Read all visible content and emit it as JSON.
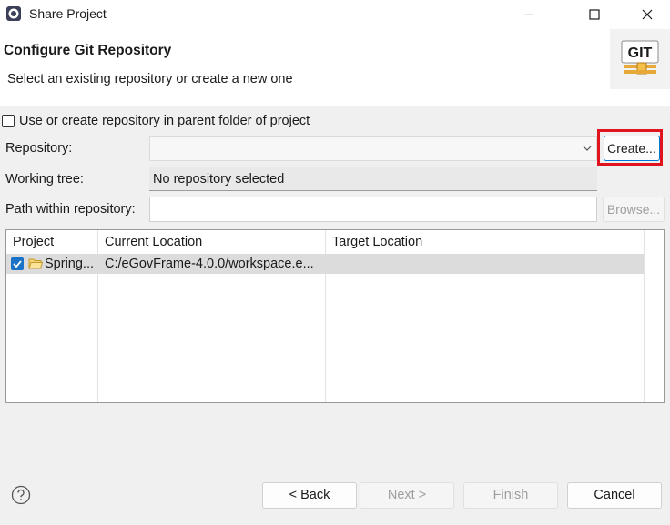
{
  "window": {
    "title": "Share Project"
  },
  "header": {
    "title": "Configure Git Repository",
    "subtitle": "Select an existing repository or create a new one",
    "logo_text": "GIT"
  },
  "form": {
    "parent_folder_checkbox": {
      "label": "Use or create repository in parent folder of project",
      "checked": false
    },
    "repository_label": "Repository:",
    "repository_value": "",
    "create_button": "Create...",
    "working_tree_label": "Working tree:",
    "working_tree_value": "No repository selected",
    "path_label": "Path within repository:",
    "path_value": "",
    "browse_button": "Browse..."
  },
  "table": {
    "columns": [
      "Project",
      "Current Location",
      "Target Location"
    ],
    "rows": [
      {
        "project": "Spring...",
        "current_location": "C:/eGovFrame-4.0.0/workspace.e...",
        "target_location": "",
        "checked": true
      }
    ]
  },
  "footer": {
    "back": "< Back",
    "next": "Next >",
    "finish": "Finish",
    "cancel": "Cancel"
  },
  "colors": {
    "highlight": "#e0141e",
    "accent": "#0078d4",
    "checkbox": "#1a73c7"
  }
}
